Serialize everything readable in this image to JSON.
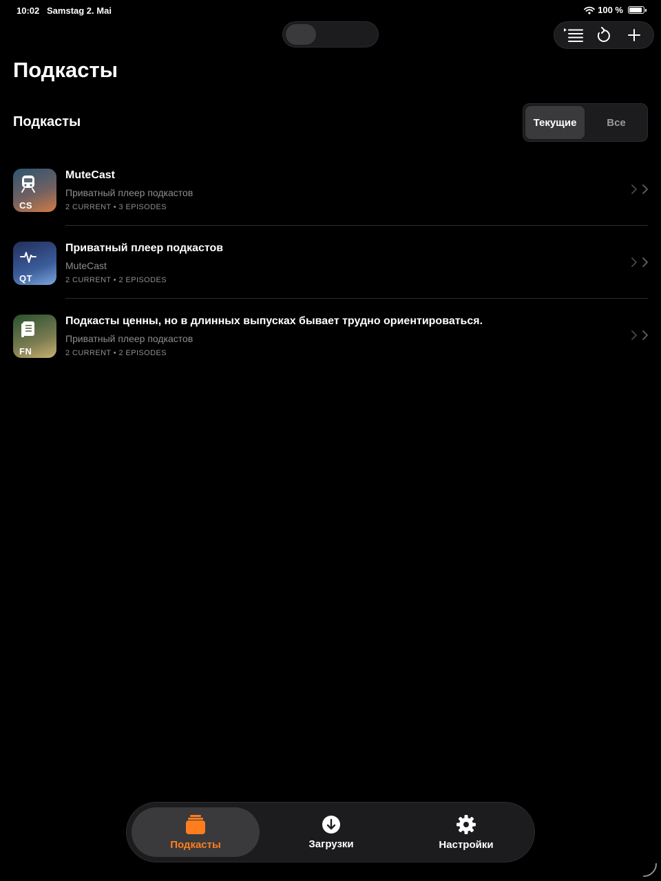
{
  "status_bar": {
    "time": "10:02",
    "date": "Samstag 2. Mai",
    "battery_text": "100 %",
    "wifi_icon": "wifi-icon",
    "battery_icon": "battery-icon"
  },
  "toolbar": {
    "icons": [
      "queue-list-icon",
      "refresh-icon",
      "plus-icon"
    ]
  },
  "page": {
    "title": "Подкасты"
  },
  "section": {
    "title": "Подкасты",
    "filter": {
      "current_label": "Текущие",
      "all_label": "Все",
      "selected": "Текущие"
    }
  },
  "podcasts": [
    {
      "title": "MuteCast",
      "subtitle": "Приватный плеер подкастов",
      "meta": "2 CURRENT • 3 EPISODES",
      "art_code": "CS",
      "art_icon": "train-icon"
    },
    {
      "title": "Приватный плеер подкастов",
      "subtitle": "MuteCast",
      "meta": "2 CURRENT • 2 EPISODES",
      "art_code": "QT",
      "art_icon": "waveform-icon"
    },
    {
      "title": "Подкасты ценны, но в длинных выпусках бывает трудно ориентироваться.",
      "subtitle": "Приватный плеер подкастов",
      "meta": "2 CURRENT • 2 EPISODES",
      "art_code": "FN",
      "art_icon": "document-icon"
    }
  ],
  "tabbar": {
    "tabs": [
      {
        "label": "Подкасты",
        "icon": "podcasts-stack-icon",
        "selected": true
      },
      {
        "label": "Загрузки",
        "icon": "download-icon",
        "selected": false
      },
      {
        "label": "Настройки",
        "icon": "gear-icon",
        "selected": false
      }
    ]
  },
  "colors": {
    "accent": "#ff7d1f",
    "background": "#000000",
    "secondary_text": "#8e8e93"
  }
}
